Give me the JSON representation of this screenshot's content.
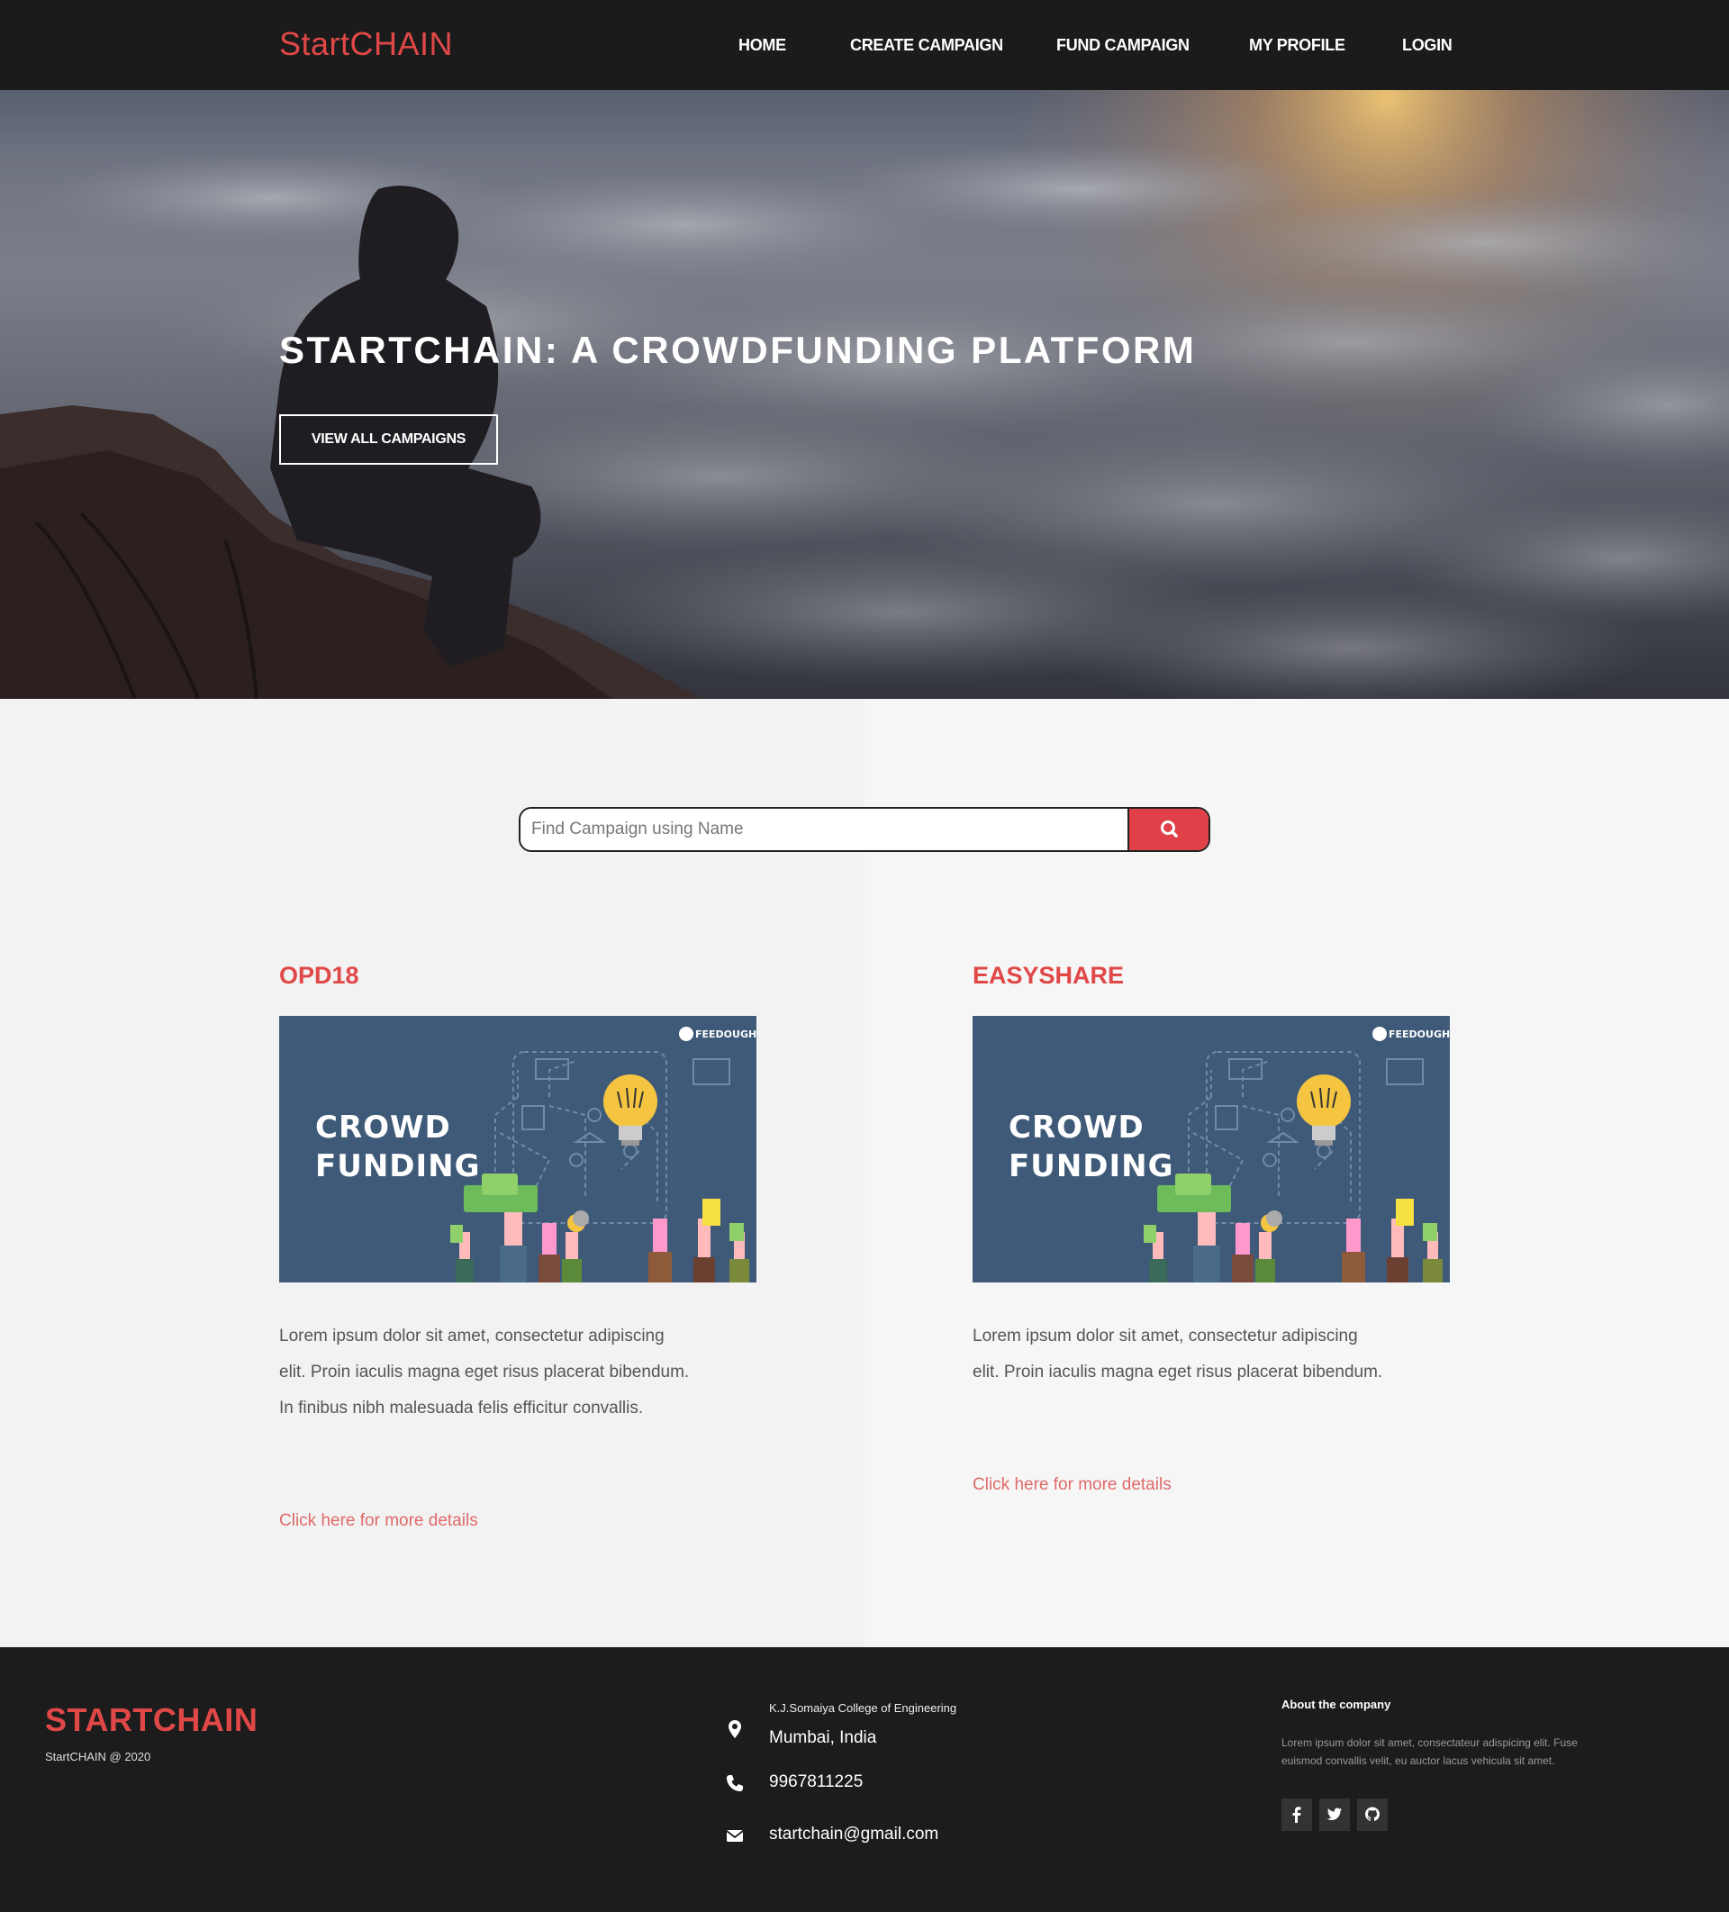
{
  "nav": {
    "logo": "StartCHAIN",
    "items": [
      "HOME",
      "CREATE CAMPAIGN",
      "FUND CAMPAIGN",
      "MY PROFILE",
      "LOGIN"
    ]
  },
  "hero": {
    "title": "STARTCHAIN: A CROWDFUNDING PLATFORM",
    "button": "VIEW ALL CAMPAIGNS"
  },
  "search": {
    "placeholder": "Find Campaign using Name",
    "button_icon": "search-icon"
  },
  "campaigns": [
    {
      "name": "OPD18",
      "image_text": [
        "CROWD",
        "FUNDING"
      ],
      "image_brand": "FEEDOUGH",
      "description": "Lorem ipsum dolor sit amet, consectetur adipiscing elit. Proin iaculis magna eget risus placerat bibendum. In finibus nibh malesuada felis efficitur convallis.",
      "link": "Click here for more details"
    },
    {
      "name": "EASYSHARE",
      "image_text": [
        "CROWD",
        "FUNDING"
      ],
      "image_brand": "FEEDOUGH",
      "description": "Lorem ipsum dolor sit amet, consectetur adipiscing elit. Proin iaculis magna eget risus placerat bibendum.",
      "link": "Click here for more details"
    }
  ],
  "footer": {
    "brand": "STARTCHAIN",
    "copyright": "StartCHAIN @ 2020",
    "college": "K.J.Somaiya College of Engineering",
    "city": "Mumbai, India",
    "phone": "9967811225",
    "email": "startchain@gmail.com",
    "about_heading": "About the company",
    "about_text": "Lorem ipsum dolor sit amet, consectateur adispicing elit. Fuse euismod convallis velit, eu auctor lacus vehicula sit amet.",
    "social_icons": [
      "facebook-icon",
      "twitter-icon",
      "github-icon"
    ]
  },
  "colors": {
    "accent": "#e04848",
    "nav_bg": "#1b1b1b",
    "footer_bg": "#1c1c1c",
    "card_image_bg": "#3f5a78"
  }
}
